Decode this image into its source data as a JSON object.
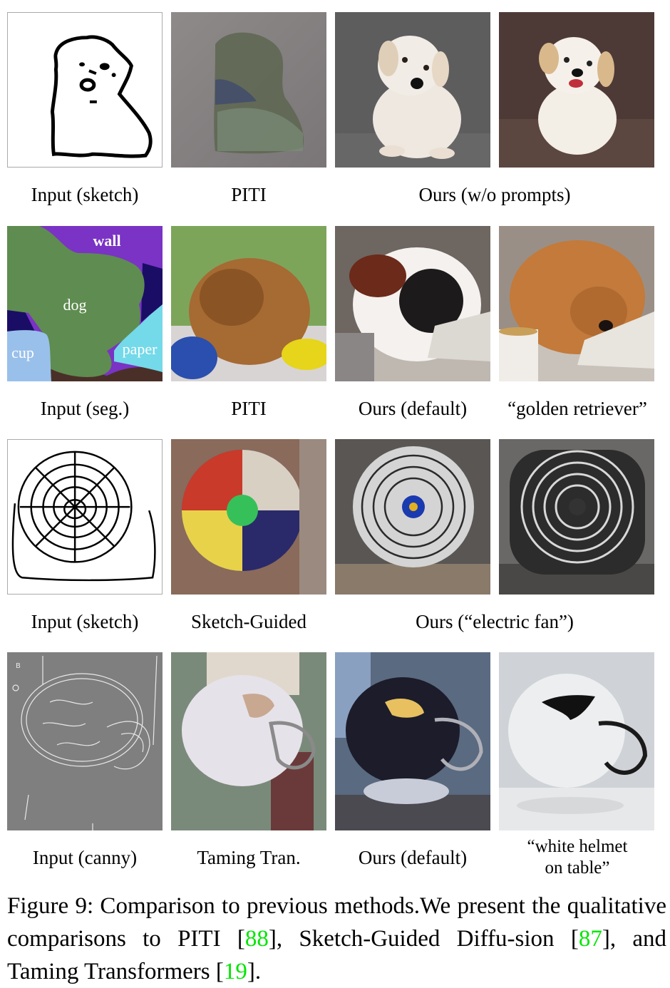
{
  "figure": {
    "rows": [
      {
        "labels": {
          "col1": "Input (sketch)",
          "col2": "PITI",
          "col34": "Ours (w/o prompts)"
        },
        "images": [
          {
            "name": "input-sketch-dog",
            "description": "Black line sketch of a fluffy dog on white"
          },
          {
            "name": "piti-output-dog-sketch",
            "description": "Muddy textured dog shape on grey background"
          },
          {
            "name": "ours-output-white-puppy-grey",
            "description": "White puppy lying on grey backdrop"
          },
          {
            "name": "ours-output-white-puppy-brown",
            "description": "White fluffy puppy sitting on brown couch"
          }
        ]
      },
      {
        "labels": {
          "col1": "Input (seg.)",
          "col2": "PITI",
          "col3": "Ours (default)",
          "col4": "“golden retriever”"
        },
        "segmentation_labels": [
          "wall",
          "dog",
          "cup",
          "paper"
        ],
        "segmentation_colors": {
          "wall": "#7a33c4",
          "dog": "#5f8c50",
          "cup": "#99c0ea",
          "paper": "#74d9e9",
          "floor": "#4a2f28",
          "background_dark": "#1a0d66"
        },
        "images": [
          {
            "name": "input-segmentation-map",
            "description": "Segmentation map with wall, dog, cup, paper regions"
          },
          {
            "name": "piti-output-dog-seg",
            "description": "Brown dog lying on pillows"
          },
          {
            "name": "ours-output-black-white-dog",
            "description": "Black and white dog resting on newspaper near a cup"
          },
          {
            "name": "ours-output-golden-retriever",
            "description": "Golden retriever lying on newspaper with a mug"
          }
        ]
      },
      {
        "labels": {
          "col1": "Input (sketch)",
          "col2": "Sketch-Guided",
          "col34": "Ours (“electric fan”)"
        },
        "images": [
          {
            "name": "input-sketch-fan",
            "description": "Black line sketch of a fan grille"
          },
          {
            "name": "sketch-guided-output-fan",
            "description": "Colorful abstract fan image"
          },
          {
            "name": "ours-output-fan-1",
            "description": "Silver desk fan with blue center badge"
          },
          {
            "name": "ours-output-fan-2",
            "description": "Chrome desk fan on grey background"
          }
        ]
      },
      {
        "labels": {
          "col1": "Input (canny)",
          "col2": "Taming Tran.",
          "col3": "Ours (default)",
          "col4_line1": "“white helmet",
          "col4_line2": "on table”"
        },
        "images": [
          {
            "name": "input-canny-helmet",
            "description": "White canny edges of a football helmet on grey"
          },
          {
            "name": "taming-transformer-output-helmet",
            "description": "Blurry pale helmet"
          },
          {
            "name": "ours-output-dark-helmet",
            "description": "Dark glossy helmet with longhorn logo on stand"
          },
          {
            "name": "ours-output-white-helmet",
            "description": "White helmet with black longhorn logo on table"
          }
        ]
      }
    ],
    "caption": {
      "prefix": "Figure 9: Comparison to previous methods.We present the qualitative comparisons to PITI [",
      "cite1": "88",
      "mid1": "], Sketch-Guided Diffu-sion [",
      "cite2": "87",
      "mid2": "], and Taming Transformers [",
      "cite3": "19",
      "suffix": "]."
    },
    "colors": {
      "citation": "#00e600",
      "text": "#000000"
    }
  }
}
